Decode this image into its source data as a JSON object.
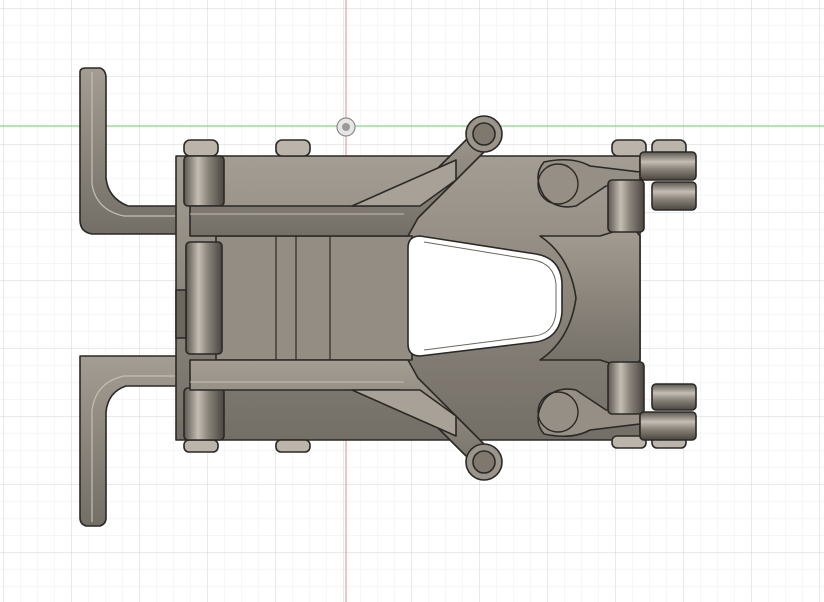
{
  "viewport": {
    "view": "top",
    "background_color": "#ffffff",
    "grid": {
      "visible": true,
      "minor_color": "#eceef0",
      "major_color": "#cfd4d8"
    },
    "axes": {
      "x_axis_color": "#8fd18f",
      "y_axis_color": "#e3a0a0",
      "origin_marker_icon": "origin-point-icon"
    }
  },
  "model": {
    "body_color": "#8b857c",
    "body_dark_color": "#5a554e",
    "edge_color": "#2b2926",
    "highlight_color": "#c4beb4",
    "components": [
      "left-bracket-top",
      "left-bracket-bottom",
      "hinge-pin-upper",
      "hinge-pin-middle",
      "hinge-pin-lower",
      "main-body",
      "upper-strut",
      "lower-strut",
      "center-cutout",
      "right-knuckle-upper",
      "right-knuckle-lower"
    ]
  }
}
